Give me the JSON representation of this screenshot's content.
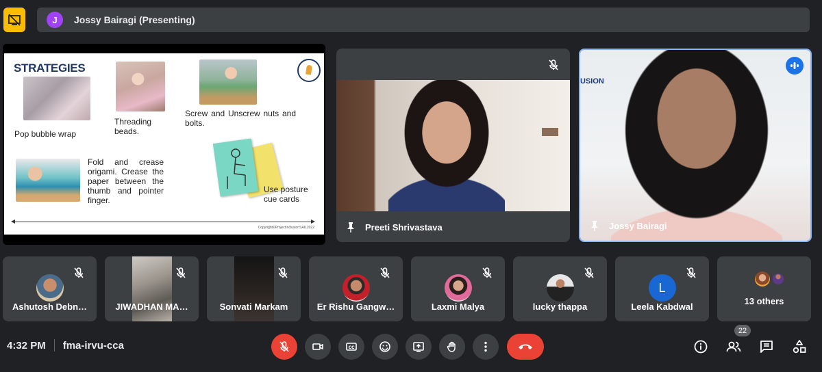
{
  "presenter_bar": {
    "avatar_letter": "J",
    "text": "Jossy Bairagi (Presenting)"
  },
  "slide": {
    "title": "STRATEGIES",
    "items": [
      "Pop bubble wrap",
      "Threading beads.",
      "Screw and Unscrew nuts and bolts.",
      "Fold and crease origami. Crease the paper between the thumb and pointer finger.",
      "Use posture cue cards"
    ],
    "copyright": "Copyright©ProjectInclusionSAIL2022"
  },
  "main_tiles": [
    {
      "name": "Preeti Shrivastava",
      "muted": true
    },
    {
      "name": "Jossy Bairagi",
      "speaking": true
    }
  ],
  "participants": [
    {
      "name": "Ashutosh Debn…",
      "muted": true
    },
    {
      "name": "JIWADHAN MA…",
      "muted": true
    },
    {
      "name": "Sonvati Markam",
      "muted": true
    },
    {
      "name": "Er Rishu Gangw…",
      "muted": true
    },
    {
      "name": "Laxmi Malya",
      "muted": true
    },
    {
      "name": "lucky thappa",
      "muted": true
    },
    {
      "name": "Leela Kabdwal",
      "avatar_letter": "L",
      "muted": true
    },
    {
      "name": "13 others"
    }
  ],
  "bottom_bar": {
    "time": "4:32 PM",
    "meeting_code": "fma-irvu-cca",
    "participant_count": "22"
  },
  "colors": {
    "background": "#202124",
    "tile": "#3c4043",
    "accent_blue": "#8ab4f8",
    "danger": "#ea4335",
    "present_yellow": "#fbbc04"
  },
  "icons": [
    "stop-presenting-icon",
    "mic-off-icon",
    "pin-icon",
    "speaking-icon",
    "camera-icon",
    "captions-icon",
    "emoji-icon",
    "present-icon",
    "raise-hand-icon",
    "more-options-icon",
    "end-call-icon",
    "info-icon",
    "people-icon",
    "chat-icon",
    "activities-icon"
  ]
}
